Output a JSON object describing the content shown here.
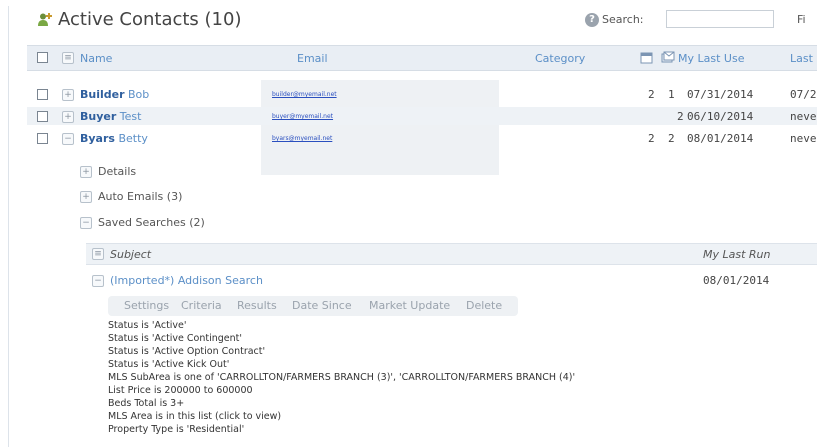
{
  "header": {
    "title": "Active Contacts (10)",
    "search_label": "Search:",
    "search_value": "",
    "filter_label": "Fi"
  },
  "columns": {
    "name": "Name",
    "email": "Email",
    "category": "Category",
    "my_last_use": "My Last Use",
    "last": "Last"
  },
  "contacts": [
    {
      "first": "Builder",
      "last": "Bob",
      "email": "builder@myemail.net",
      "c1": "2",
      "c2": "1",
      "my_last_use": "07/31/2014",
      "last_col": "07/2"
    },
    {
      "first": "Buyer",
      "last": "Test",
      "email": "buyer@myemail.net",
      "c1": "",
      "c2": "2",
      "my_last_use": "06/10/2014",
      "last_col": "neve"
    },
    {
      "first": "Byars",
      "last": "Betty",
      "email": "byars@myemail.net",
      "c1": "2",
      "c2": "2",
      "my_last_use": "08/01/2014",
      "last_col": "neve"
    }
  ],
  "expanded": {
    "details": "Details",
    "auto_emails": "Auto Emails (3)",
    "saved_searches": "Saved Searches (2)"
  },
  "saved_search_table": {
    "subject_header": "Subject",
    "last_run_header": "My Last Run",
    "item_subject": "(Imported*) Addison Search",
    "item_last_run": "08/01/2014"
  },
  "tabs": [
    "Settings",
    "Criteria",
    "Results",
    "Date Since",
    "Market Update",
    "Delete"
  ],
  "criteria": [
    "Status is 'Active'",
    "Status is 'Active Contingent'",
    "Status is 'Active Option Contract'",
    "Status is 'Active Kick Out'",
    "MLS SubArea is one of 'CARROLLTON/FARMERS BRANCH (3)', 'CARROLLTON/FARMERS BRANCH (4)'",
    "List Price is 200000 to 600000",
    "Beds Total is 3+",
    "MLS Area is in this list (click to view)",
    "Property Type is 'Residential'"
  ],
  "icons": {
    "header": "contacts-add-icon",
    "help": "help-icon",
    "expand": "plus-icon",
    "collapse": "minus-icon"
  }
}
